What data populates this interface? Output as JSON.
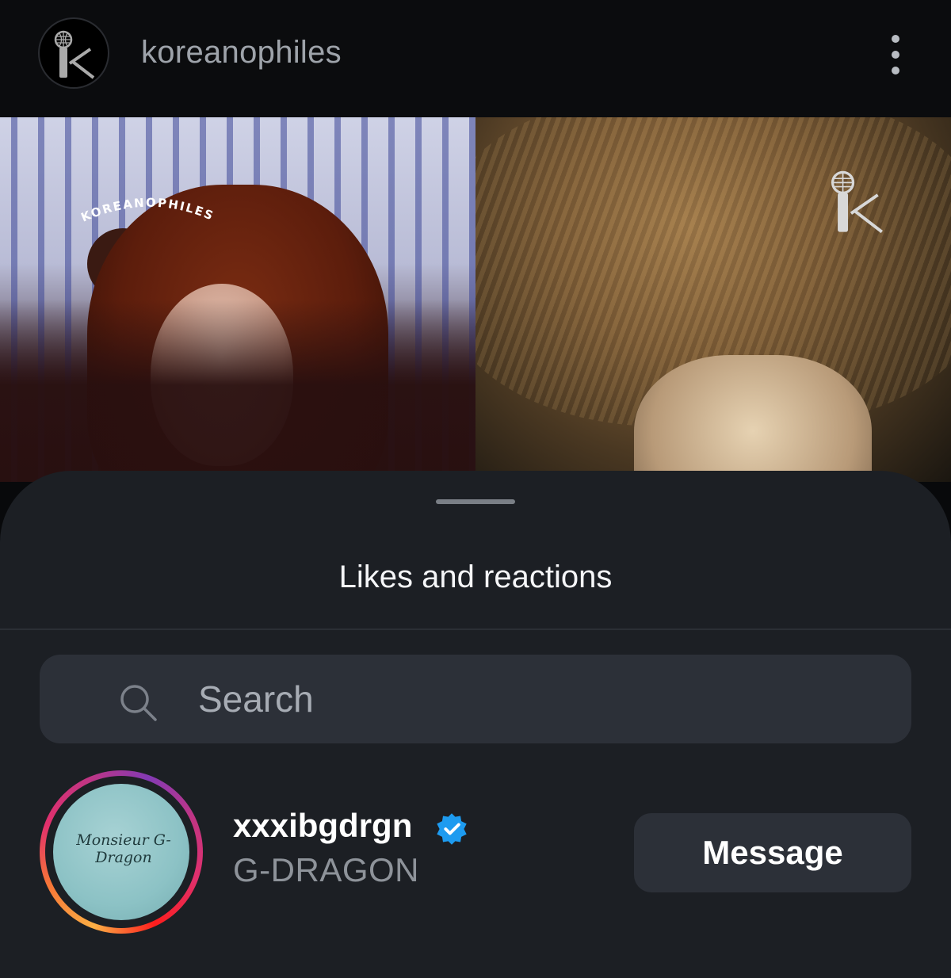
{
  "post": {
    "username": "koreanophiles",
    "avatar_icon": "microphone-k-logo-icon",
    "more_icon": "more-vertical-icon",
    "left_photo_watermark": "KOREANOPHILES"
  },
  "sheet": {
    "title": "Likes and reactions",
    "search": {
      "placeholder": "Search",
      "icon": "search-icon"
    },
    "users": [
      {
        "username": "xxxibgdrgn",
        "full_name": "G-DRAGON",
        "verified": true,
        "avatar_signature": "Monsieur G-Dragon",
        "action_label": "Message"
      }
    ]
  },
  "colors": {
    "sheet_bg": "#1c1f24",
    "field_bg": "#2c3038",
    "verified_blue": "#1d9bf0"
  }
}
